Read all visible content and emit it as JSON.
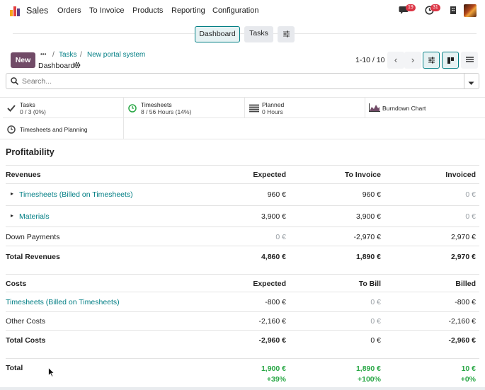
{
  "topbar": {
    "app_name": "Sales",
    "menu": [
      "Orders",
      "To Invoice",
      "Products",
      "Reporting",
      "Configuration"
    ],
    "chat_count": "19",
    "activity_count": "31"
  },
  "toggles": {
    "dashboard": "Dashboard",
    "tasks": "Tasks"
  },
  "control": {
    "new_label": "New",
    "more": "•••",
    "breadcrumb": [
      "Tasks",
      "New portal system"
    ],
    "current": "Dashboard",
    "pager": "1-10 / 10"
  },
  "search": {
    "placeholder": "Search..."
  },
  "stats": [
    {
      "title": "Tasks",
      "sub": "0 / 3 (0%)",
      "icon": "check-icon"
    },
    {
      "title": "Timesheets",
      "sub": "8 / 56 Hours (14%)",
      "icon": "clock-icon"
    },
    {
      "title": "Planned",
      "sub": "0 Hours",
      "icon": "tasks-icon"
    },
    {
      "title": "Burndown Chart",
      "sub": "",
      "icon": "area-chart-icon"
    },
    {
      "title": "Timesheets and Planning",
      "sub": "",
      "icon": "clock-icon"
    }
  ],
  "profitability": {
    "title": "Profitability",
    "revenues": {
      "headers": [
        "Revenues",
        "Expected",
        "To Invoice",
        "Invoiced"
      ],
      "rows": [
        {
          "label": "Timesheets (Billed on Timesheets)",
          "expected": "960 €",
          "to_invoice": "960 €",
          "invoiced": "0 €"
        },
        {
          "label": "Materials",
          "expected": "3,900 €",
          "to_invoice": "3,900 €",
          "invoiced": "0 €"
        },
        {
          "label": "Down Payments",
          "expected": "0 €",
          "to_invoice": "-2,970 €",
          "invoiced": "2,970 €"
        }
      ],
      "total": {
        "label": "Total Revenues",
        "expected": "4,860 €",
        "to_invoice": "1,890 €",
        "invoiced": "2,970 €"
      }
    },
    "costs": {
      "headers": [
        "Costs",
        "Expected",
        "To Bill",
        "Billed"
      ],
      "rows": [
        {
          "label": "Timesheets (Billed on Timesheets)",
          "expected": "-800 €",
          "to_bill": "0 €",
          "billed": "-800 €"
        },
        {
          "label": "Other Costs",
          "expected": "-2,160 €",
          "to_bill": "0 €",
          "billed": "-2,160 €"
        }
      ],
      "total": {
        "label": "Total Costs",
        "expected": "-2,960 €",
        "to_bill": "0 €",
        "billed": "-2,960 €"
      }
    },
    "total": {
      "label": "Total",
      "expected": "1,900 €",
      "expected_pct": "+39%",
      "to_invoice": "1,890 €",
      "to_invoice_pct": "+100%",
      "invoiced": "10 €",
      "invoiced_pct": "+0%"
    }
  },
  "colors": {
    "brand": "#714b67",
    "link": "#017e84",
    "positive": "#28a745",
    "badge": "#dc3545"
  }
}
